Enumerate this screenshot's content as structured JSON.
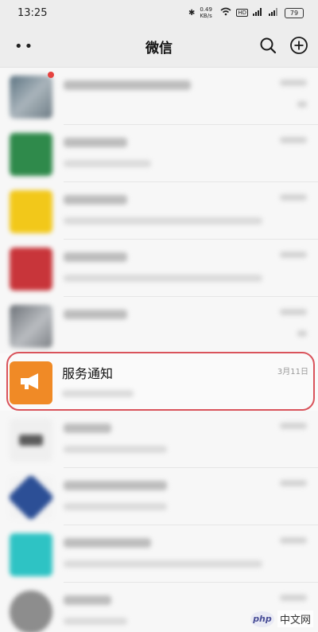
{
  "status_bar": {
    "time": "13:25",
    "network_speed": "0.49 KB/s",
    "battery": "79"
  },
  "nav": {
    "title": "微信",
    "more_icon": "more-dots-icon",
    "search_icon": "search-icon",
    "add_icon": "plus-circle-icon"
  },
  "chats": [
    {
      "avatar_color": "#7a8a96",
      "unread": true,
      "blurred": true
    },
    {
      "avatar_color": "#2f8a4b",
      "unread": false,
      "blurred": true
    },
    {
      "avatar_color": "#f2c81a",
      "unread": false,
      "blurred": true
    },
    {
      "avatar_color": "#c8353a",
      "unread": false,
      "blurred": true
    },
    {
      "avatar_color": "#8c9096",
      "unread": false,
      "blurred": true
    },
    {
      "name": "服务通知",
      "time": "3月11日",
      "avatar_color": "#f08a26",
      "highlighted": true
    },
    {
      "avatar_color": "#5b5b5b",
      "unread": false,
      "blurred": true
    },
    {
      "avatar_color": "#2c4f96",
      "unread": false,
      "blurred": true
    },
    {
      "avatar_color": "#2ec3c4",
      "unread": false,
      "blurred": true
    },
    {
      "avatar_color": "#8d8d8d",
      "unread": false,
      "blurred": true
    }
  ],
  "watermark": {
    "logo": "php",
    "text": "中文网"
  }
}
